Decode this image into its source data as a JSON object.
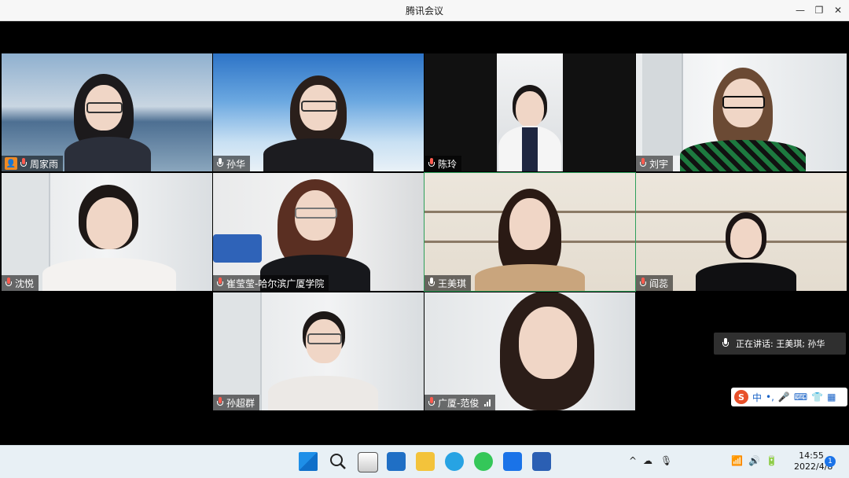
{
  "window": {
    "title": "腾讯会议",
    "minimize": "—",
    "maximize": "❐",
    "close": "✕"
  },
  "participants": [
    {
      "name": "周家雨",
      "host": true,
      "mic": "muted"
    },
    {
      "name": "孙华",
      "mic": "on"
    },
    {
      "name": "陈玲",
      "mic": "muted"
    },
    {
      "name": "刘宇",
      "mic": "muted"
    },
    {
      "name": "沈悦",
      "mic": "muted"
    },
    {
      "name": "崔莹莹-哈尔滨广厦学院",
      "mic": "muted"
    },
    {
      "name": "王美琪",
      "mic": "on",
      "active": true
    },
    {
      "name": "阎蕊",
      "mic": "muted"
    },
    {
      "name": "孙超群",
      "mic": "muted"
    },
    {
      "name": "广厦-范俊",
      "mic": "muted"
    }
  ],
  "speaking": {
    "label": "正在讲话: 王美琪; 孙华"
  },
  "ime": {
    "logo": "S",
    "mode": "中",
    "punct": "•,",
    "voice": "🎤",
    "keyboard": "⌨",
    "skin": "👕",
    "toolbox": "▦"
  },
  "taskbar": {
    "clock_time": "14:55",
    "clock_date": "2022/4/8",
    "notification_count": "1",
    "tray_chevron": "^",
    "tray_cloud": "☁",
    "tray_mic": "🎙",
    "tray_wifi": "📶",
    "tray_volume": "🔊",
    "tray_battery": "🔋"
  }
}
